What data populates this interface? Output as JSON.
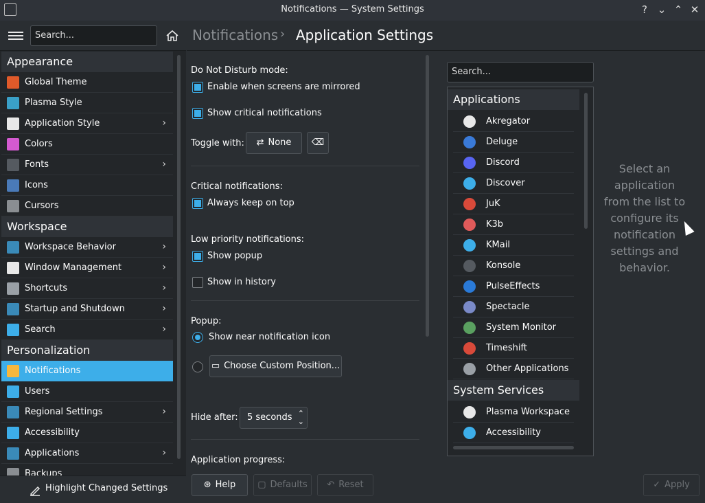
{
  "window": {
    "title": "Notifications — System Settings",
    "help": "?",
    "minimize": "⌄",
    "maximize": "⌃",
    "close": "✕"
  },
  "sidebar": {
    "search_placeholder": "Search...",
    "categories": [
      {
        "name": "Appearance",
        "items": [
          {
            "label": "Global Theme",
            "icon": "global-theme-icon",
            "color": "#e05a2a",
            "chevron": false
          },
          {
            "label": "Plasma Style",
            "icon": "plasma-style-icon",
            "color": "#3aa0c8",
            "chevron": false
          },
          {
            "label": "Application Style",
            "icon": "application-style-icon",
            "color": "#e8e8e8",
            "chevron": true
          },
          {
            "label": "Colors",
            "icon": "colors-icon",
            "color": "#d45ad0",
            "chevron": false
          },
          {
            "label": "Fonts",
            "icon": "fonts-icon",
            "color": "#555a60",
            "chevron": true
          },
          {
            "label": "Icons",
            "icon": "icons-icon",
            "color": "#4a7ab8",
            "chevron": false
          },
          {
            "label": "Cursors",
            "icon": "cursors-icon",
            "color": "#8a8e92",
            "chevron": false
          }
        ]
      },
      {
        "name": "Workspace",
        "items": [
          {
            "label": "Workspace Behavior",
            "icon": "workspace-behavior-icon",
            "color": "#3a8ab8",
            "chevron": true
          },
          {
            "label": "Window Management",
            "icon": "window-management-icon",
            "color": "#e8e8e8",
            "chevron": true
          },
          {
            "label": "Shortcuts",
            "icon": "shortcuts-icon",
            "color": "#9aa0a6",
            "chevron": true
          },
          {
            "label": "Startup and Shutdown",
            "icon": "startup-shutdown-icon",
            "color": "#3a8ab8",
            "chevron": true
          },
          {
            "label": "Search",
            "icon": "search-icon",
            "color": "#3daee9",
            "chevron": true
          }
        ]
      },
      {
        "name": "Personalization",
        "items": [
          {
            "label": "Notifications",
            "icon": "bell-icon",
            "color": "#f6b73c",
            "chevron": false,
            "active": true
          },
          {
            "label": "Users",
            "icon": "users-icon",
            "color": "#3daee9",
            "chevron": false
          },
          {
            "label": "Regional Settings",
            "icon": "regional-settings-icon",
            "color": "#3a8ab8",
            "chevron": true
          },
          {
            "label": "Accessibility",
            "icon": "accessibility-icon",
            "color": "#3daee9",
            "chevron": false
          },
          {
            "label": "Applications",
            "icon": "applications-icon",
            "color": "#3a8ab8",
            "chevron": true
          },
          {
            "label": "Backups",
            "icon": "backups-icon",
            "color": "#8a8e92",
            "chevron": false
          }
        ]
      }
    ],
    "footer": "Highlight Changed Settings"
  },
  "breadcrumb": {
    "parent": "Notifications",
    "current": "Application Settings"
  },
  "settings": {
    "dnd_label": "Do Not Disturb mode:",
    "dnd_mirrored": "Enable when screens are mirrored",
    "dnd_critical": "Show critical notifications",
    "toggle_label": "Toggle with:",
    "toggle_value": "None",
    "critical_label": "Critical notifications:",
    "critical_keep_top": "Always keep on top",
    "low_label": "Low priority notifications:",
    "low_popup": "Show popup",
    "low_history": "Show in history",
    "popup_label": "Popup:",
    "popup_near": "Show near notification icon",
    "popup_custom": "Choose Custom Position...",
    "hide_label": "Hide after:",
    "hide_value": "5 seconds",
    "progress_label": "Application progress:"
  },
  "apps": {
    "search_placeholder": "Search...",
    "applications_header": "Applications",
    "applications": [
      {
        "label": "Akregator",
        "icon": "rss-icon",
        "color": "#e8e8e8"
      },
      {
        "label": "Deluge",
        "icon": "deluge-icon",
        "color": "#3a7ad8"
      },
      {
        "label": "Discord",
        "icon": "discord-icon",
        "color": "#5865f2"
      },
      {
        "label": "Discover",
        "icon": "discover-icon",
        "color": "#3daee9"
      },
      {
        "label": "JuK",
        "icon": "juk-icon",
        "color": "#d94a3a"
      },
      {
        "label": "K3b",
        "icon": "k3b-icon",
        "color": "#e05a5a"
      },
      {
        "label": "KMail",
        "icon": "kmail-icon",
        "color": "#3daee9"
      },
      {
        "label": "Konsole",
        "icon": "konsole-icon",
        "color": "#555a60"
      },
      {
        "label": "PulseEffects",
        "icon": "pulseeffects-icon",
        "color": "#2a7ad8"
      },
      {
        "label": "Spectacle",
        "icon": "spectacle-icon",
        "color": "#7a8ac8"
      },
      {
        "label": "System Monitor",
        "icon": "system-monitor-icon",
        "color": "#5aa060"
      },
      {
        "label": "Timeshift",
        "icon": "timeshift-icon",
        "color": "#d94a3a"
      },
      {
        "label": "Other Applications",
        "icon": "other-applications-icon",
        "color": "#9aa0a6"
      }
    ],
    "services_header": "System Services",
    "services": [
      {
        "label": "Plasma Workspace",
        "icon": "plasma-workspace-icon",
        "color": "#e8e8e8"
      },
      {
        "label": "Accessibility",
        "icon": "accessibility-icon",
        "color": "#3daee9"
      }
    ],
    "placeholder": "Select an application from the list to configure its notification settings and behavior."
  },
  "footer": {
    "help": "Help",
    "defaults": "Defaults",
    "reset": "Reset",
    "apply": "Apply"
  }
}
